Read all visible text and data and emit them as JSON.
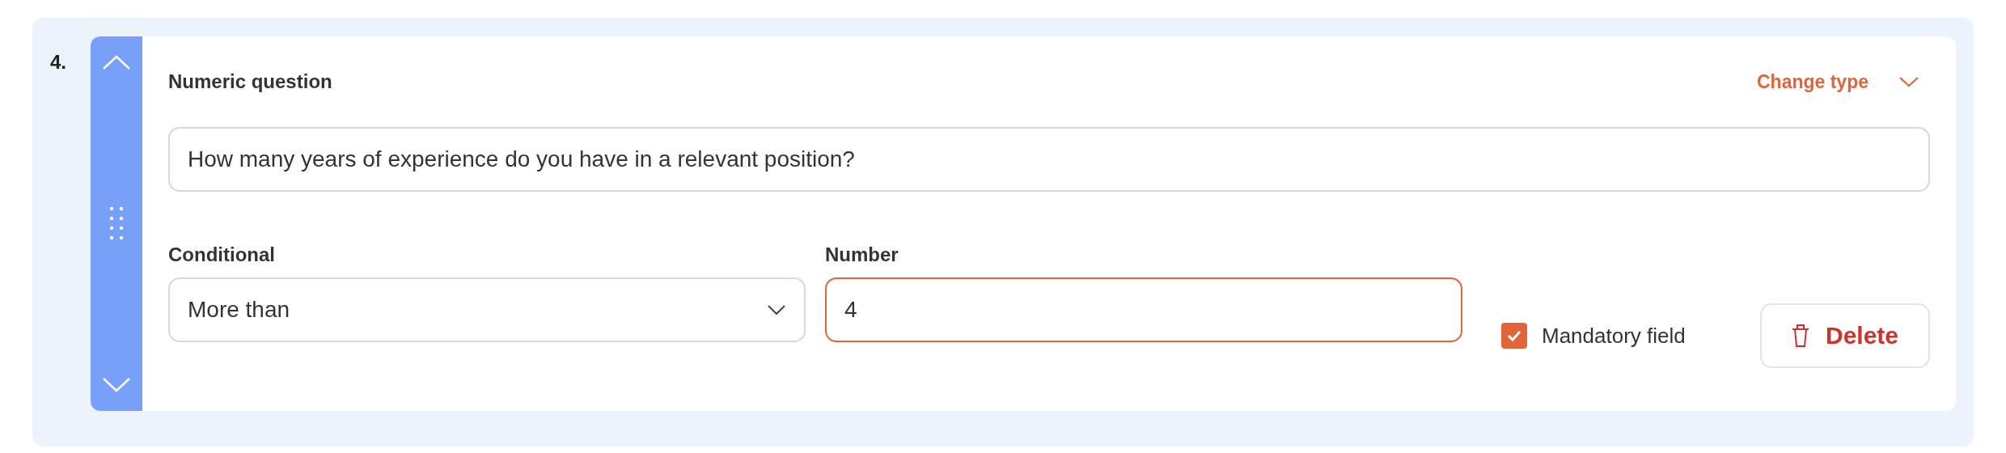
{
  "question": {
    "index": "4.",
    "type_label": "Numeric question",
    "change_type": "Change type",
    "text": "How many years of experience do you have in a relevant position?",
    "conditional": {
      "label": "Conditional",
      "value": "More than"
    },
    "number": {
      "label": "Number",
      "value": "4",
      "focused": true
    },
    "mandatory": {
      "label": "Mandatory field",
      "checked": true
    },
    "delete": "Delete"
  }
}
